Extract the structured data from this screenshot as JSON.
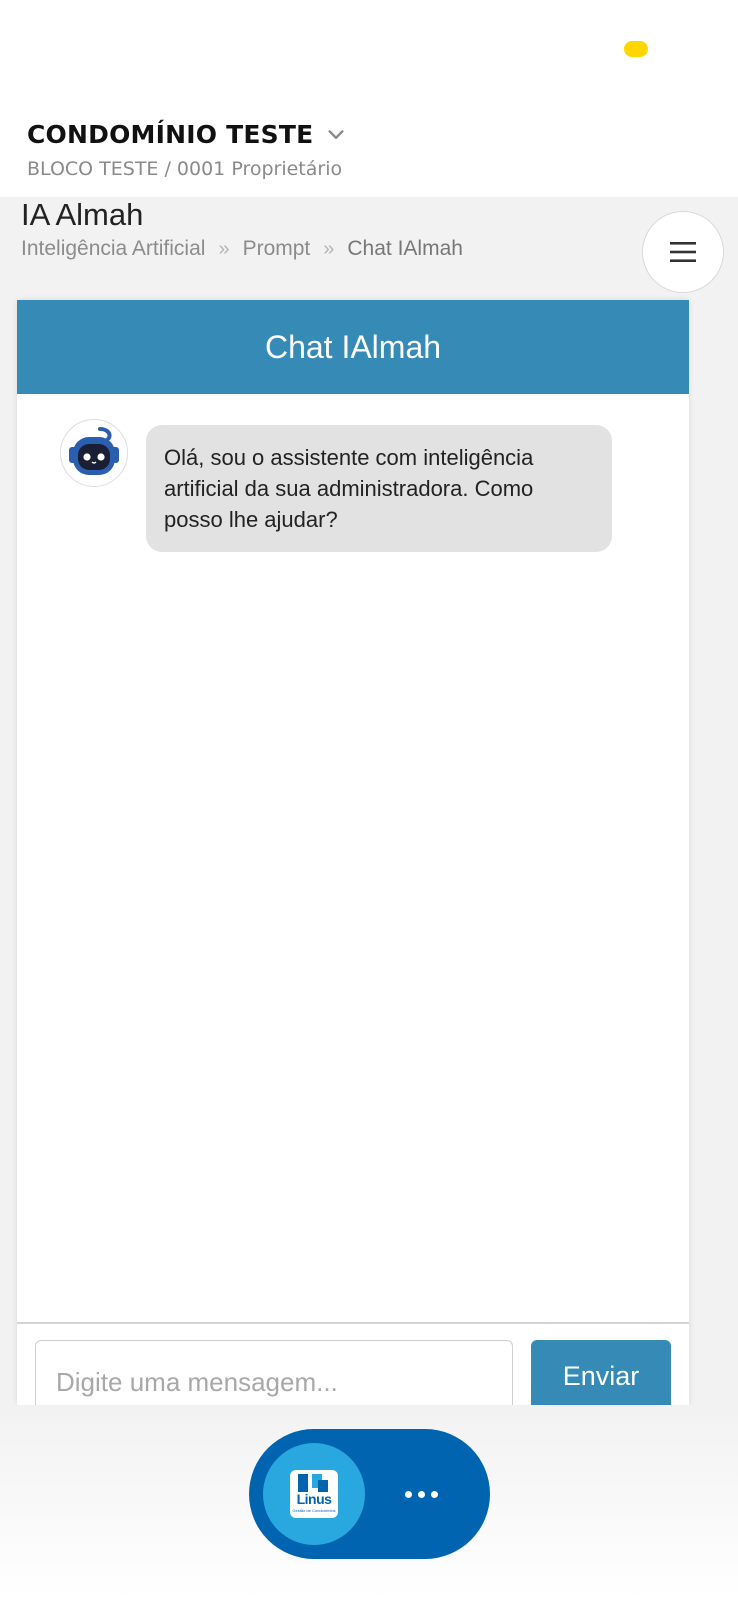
{
  "header": {
    "condo_name": "CONDOMÍNIO TESTE",
    "unit_info": "BLOCO TESTE / 0001 Proprietário"
  },
  "page": {
    "title": "IA Almah",
    "breadcrumb": [
      "Inteligência Artificial",
      "Prompt",
      "Chat IAlmah"
    ]
  },
  "chat": {
    "header_title": "Chat IAlmah",
    "messages": [
      {
        "sender": "bot",
        "text": "Olá, sou o assistente com inteligência artificial da sua administradora. Como posso lhe ajudar?"
      }
    ],
    "input_placeholder": "Digite uma mensagem...",
    "input_value": "",
    "send_label": "Enviar"
  },
  "fab": {
    "logo_text": "Linus",
    "logo_subtext": "Gestão de Condomínios"
  },
  "icons": {
    "status_indicator": "status-dot",
    "dropdown": "chevron-down-icon",
    "menu": "hamburger-menu-icon",
    "avatar": "robot-avatar-icon",
    "more": "more-dots-icon"
  },
  "colors": {
    "accent": "#368bb6",
    "fab": "#0064b0",
    "fab_logo_bg": "#29a8e0",
    "status_dot": "#ffd600",
    "bubble_bg": "#e2e2e2"
  }
}
